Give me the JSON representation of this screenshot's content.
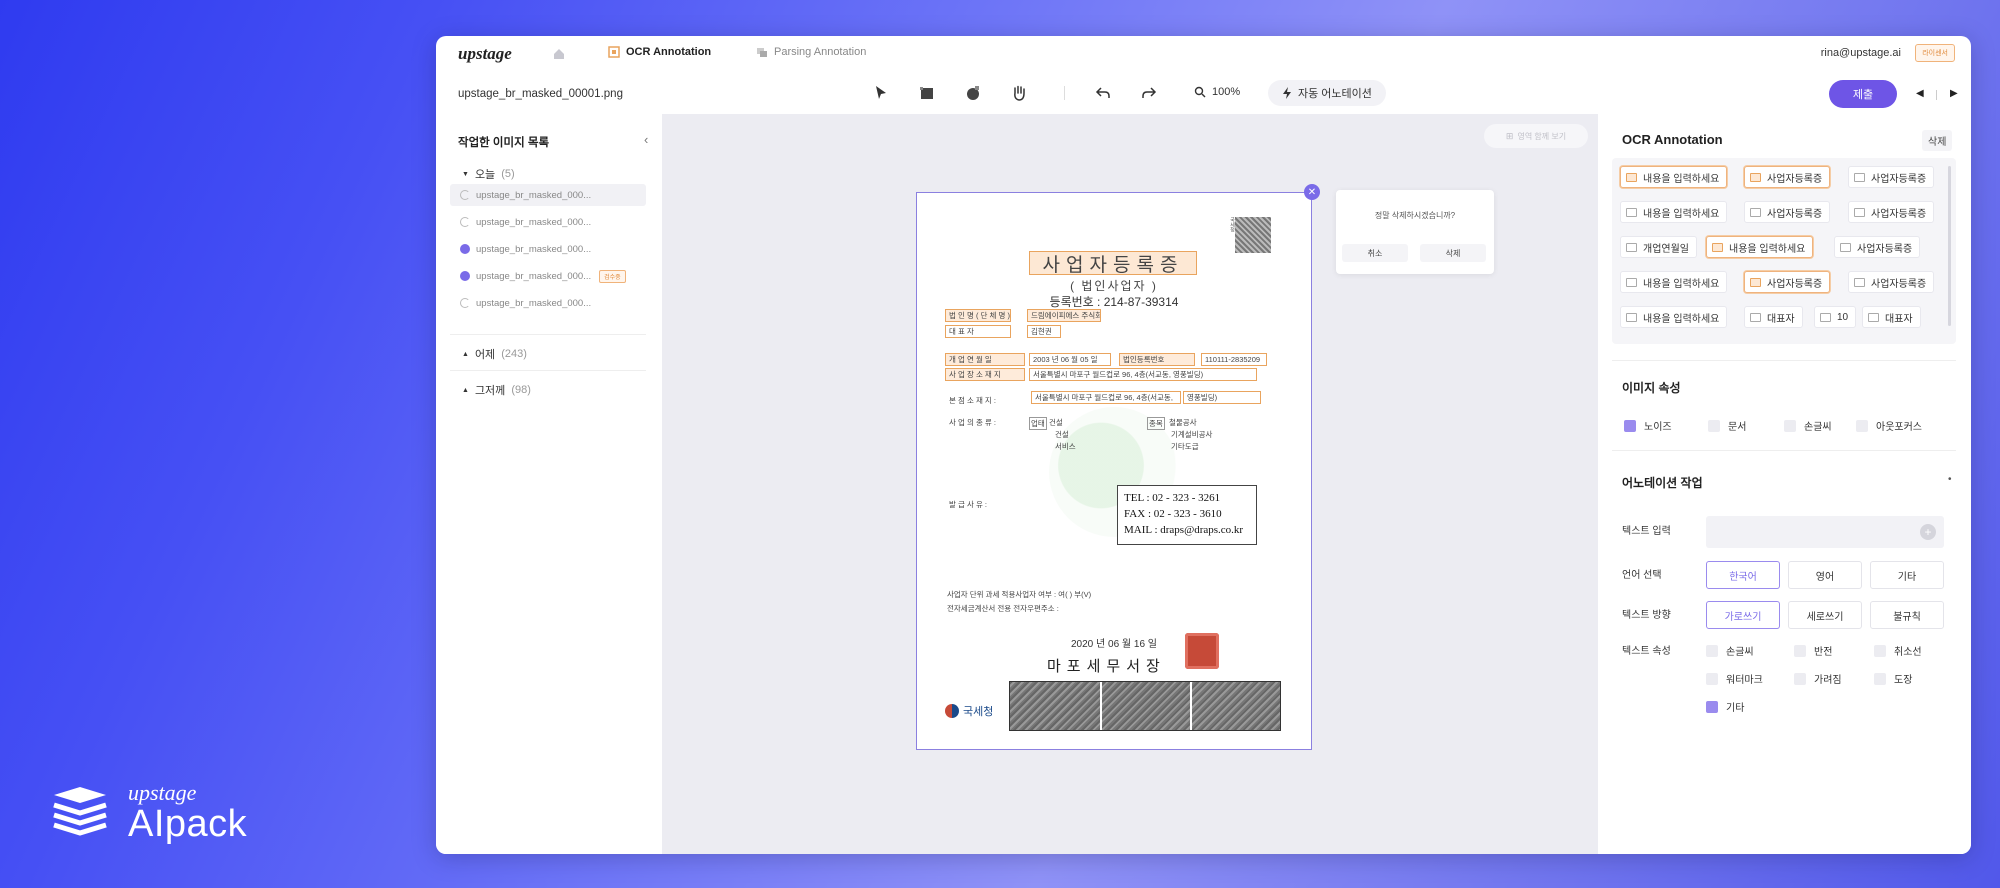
{
  "brand": {
    "small": "upstage",
    "big": "AIpack"
  },
  "header": {
    "logo": "upstage",
    "tabs": [
      {
        "label": "OCR Annotation",
        "active": true
      },
      {
        "label": "Parsing Annotation",
        "active": false
      }
    ],
    "user_email": "rina@upstage.ai",
    "user_badge": "라이센서"
  },
  "toolbar": {
    "filename": "upstage_br_masked_00001.png",
    "zoom": "100%",
    "auto_annotation": "자동 어노테이션",
    "submit_label": "제출"
  },
  "sidebar": {
    "title": "작업한 이미지 목록",
    "groups": [
      {
        "label": "오늘",
        "count": "(5)"
      },
      {
        "label": "어제",
        "count": "(243)"
      },
      {
        "label": "그저께",
        "count": "(98)"
      }
    ],
    "files": [
      {
        "name": "upstage_br_masked_000...",
        "status": "pending",
        "tag": ""
      },
      {
        "name": "upstage_br_masked_000...",
        "status": "pending",
        "tag": ""
      },
      {
        "name": "upstage_br_masked_000...",
        "status": "done",
        "tag": ""
      },
      {
        "name": "upstage_br_masked_000...",
        "status": "done",
        "tag": "검수중"
      },
      {
        "name": "upstage_br_masked_000...",
        "status": "pending",
        "tag": ""
      }
    ]
  },
  "canvas": {
    "grid_button": "영역 함께 보기",
    "delete_popup": {
      "question": "정말 삭제하시겠습니까?",
      "cancel": "취소",
      "confirm": "삭제"
    },
    "document": {
      "title": "사업자등록증",
      "subtitle": "( 법인사업자 )",
      "reg_number": "등록번호 : 214-87-39314",
      "qr_label": "국세청",
      "fields": {
        "corp_name_label": "법 인 명 ( 단 체 명 )",
        "corp_name_value": "드림에이피에스 주식회사",
        "rep_label": "대    표    자",
        "rep_value": "김현권",
        "open_date_label": "개 업 연 월 일",
        "open_date_value": "2003 년 06 월 05 일",
        "corp_reg_label": "법인등록번호",
        "corp_reg_value": "110111-2835209",
        "location_label": "사 업 장 소 재 지",
        "location_value": "서울특별시 마포구 월드컵로 96, 4층(서교동, 영풍빌딩)",
        "hq_label": "본 점 소 재 지 :",
        "hq_value": "서울특별시 마포구 월드컵로 96, 4층(서교동,",
        "hq_value2": "영풍빌딩)",
        "biz_type_label": "사 업 의   종 류 :",
        "biz_tag1": "업태",
        "biz_items1": [
          "건설",
          "건설",
          "서비스"
        ],
        "biz_tag2": "종목",
        "biz_items2": [
          "철물공사",
          "기계설비공사",
          "기타도급"
        ],
        "issue_reason_label": "발 급 사 유 :",
        "tax_line1": "사업자 단위 과세 적용사업자 여부 : 여(  ) 부(V)",
        "tax_line2": "전자세금계산서 전용 전자우편주소 :"
      },
      "contact": {
        "tel": "TEL   : 02 - 323 - 3261",
        "fax": "FAX   : 02 - 323 - 3610",
        "mail": "MAIL : draps@draps.co.kr"
      },
      "issue_date": "2020 년 06 월 16 일",
      "office": "마포세무서장",
      "footer_logo": "국세청"
    }
  },
  "annotation_panel": {
    "title": "OCR Annotation",
    "delete_label": "삭제",
    "chips": [
      {
        "label": "내용을 입력하세요",
        "hi": true
      },
      {
        "label": "사업자등록증",
        "hi": true
      },
      {
        "label": "사업자등록증",
        "hi": false
      },
      {
        "label": "내용을 입력하세요",
        "hi": false
      },
      {
        "label": "사업자등록증",
        "hi": false
      },
      {
        "label": "사업자등록증",
        "hi": false
      },
      {
        "label": "개업연월일",
        "hi": false
      },
      {
        "label": "내용을 입력하세요",
        "hi": true
      },
      {
        "label": "사업자등록증",
        "hi": false
      },
      {
        "label": "내용을 입력하세요",
        "hi": false
      },
      {
        "label": "사업자등록증",
        "hi": true
      },
      {
        "label": "사업자등록증",
        "hi": false
      },
      {
        "label": "내용을 입력하세요",
        "hi": false
      },
      {
        "label": "대표자",
        "hi": false
      },
      {
        "label": "10",
        "hi": false
      },
      {
        "label": "대표자",
        "hi": false
      }
    ],
    "image_attr": {
      "title": "이미지 속성",
      "options": [
        {
          "label": "노이즈",
          "checked": true
        },
        {
          "label": "문서",
          "checked": false
        },
        {
          "label": "손글씨",
          "checked": false
        },
        {
          "label": "아웃포커스",
          "checked": false
        }
      ]
    },
    "annotation_work": {
      "title": "어노테이션 작업",
      "text_input_label": "텍스트 입력",
      "language_label": "언어 선택",
      "languages": [
        {
          "label": "한국어",
          "on": true
        },
        {
          "label": "영어",
          "on": false
        },
        {
          "label": "기타",
          "on": false
        }
      ],
      "direction_label": "텍스트 방향",
      "directions": [
        {
          "label": "가로쓰기",
          "on": true
        },
        {
          "label": "세로쓰기",
          "on": false
        },
        {
          "label": "불규칙",
          "on": false
        }
      ],
      "text_attr_label": "텍스트 속성",
      "text_attrs": [
        {
          "label": "손글씨",
          "checked": false
        },
        {
          "label": "반전",
          "checked": false
        },
        {
          "label": "취소선",
          "checked": false
        },
        {
          "label": "워터마크",
          "checked": false
        },
        {
          "label": "가려짐",
          "checked": false
        },
        {
          "label": "도장",
          "checked": false
        },
        {
          "label": "기타",
          "checked": true
        }
      ]
    }
  }
}
